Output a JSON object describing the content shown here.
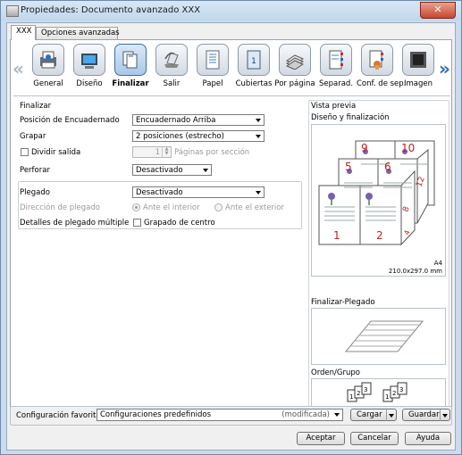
{
  "window": {
    "title": "Propiedades: Documento avanzado XXX",
    "close_glyph": "✕"
  },
  "tabs": [
    {
      "label": "XXX"
    },
    {
      "label": "Opciones avanzadas"
    }
  ],
  "nav": {
    "prev_glyph": "«",
    "next_glyph": "»"
  },
  "toolbar": [
    {
      "label": "General",
      "icon": "general-icon"
    },
    {
      "label": "Diseño",
      "icon": "layout-icon"
    },
    {
      "label": "Finalizar",
      "icon": "finishing-icon",
      "selected": true
    },
    {
      "label": "Salir",
      "icon": "output-icon"
    },
    {
      "label": "Papel",
      "icon": "paper-icon"
    },
    {
      "label": "Cubiertas",
      "icon": "covers-icon",
      "glyph": "1"
    },
    {
      "label": "Por página",
      "icon": "per-page-icon"
    },
    {
      "label": "Separad.",
      "icon": "separator-icon"
    },
    {
      "label": "Conf. de sep.",
      "icon": "separator-settings-icon"
    },
    {
      "label": "Imagen",
      "icon": "image-icon"
    }
  ],
  "finalizar": {
    "title": "Finalizar",
    "binding_position": {
      "label": "Posición de Encuadernado",
      "value": "Encuadernado Arriba"
    },
    "staple": {
      "label": "Grapar",
      "value": "2 posiciones (estrecho)"
    },
    "divide_output": {
      "label": "Dividir salida",
      "value": "1",
      "unit": "Páginas por sección",
      "checked": false
    },
    "punch": {
      "label": "Perforar",
      "value": "Desactivado"
    },
    "fold": {
      "label": "Plegado",
      "value": "Desactivado"
    },
    "fold_direction": {
      "label": "Dirección de plegado",
      "option_inside": "Ante el interior",
      "option_outside": "Ante el exterior",
      "selected": "inside"
    },
    "multi_fold": {
      "label": "Detalles de plegado múltiple",
      "checkbox_label": "Grapado de centro",
      "checked": false
    }
  },
  "preview": {
    "title": "Vista previa",
    "layout_title": "Diseño y finalización",
    "page_numbers": [
      "9",
      "10",
      "5",
      "6",
      "1",
      "2",
      "12",
      "8",
      "4"
    ],
    "paper_name": "A4",
    "paper_size": "210.0x297.0 mm",
    "fold_title": "Finalizar-Plegado",
    "order_title": "Orden/Grupo",
    "order_pages": [
      "1",
      "2",
      "3",
      "1",
      "2",
      "3"
    ]
  },
  "favorites": {
    "label": "Configuración favorita",
    "value": "Configuraciones predefinidos",
    "status": "(modificada)",
    "load_label": "Cargar",
    "save_label": "Guardar"
  },
  "buttons": {
    "ok": "Aceptar",
    "cancel": "Cancelar",
    "help": "Ayuda"
  }
}
